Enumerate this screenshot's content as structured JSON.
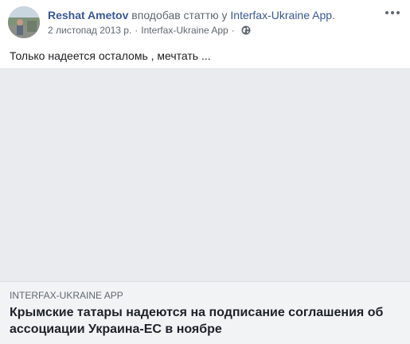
{
  "post": {
    "author": "Reshat Ametov",
    "action": "вподобав статтю у",
    "app_name": "Interfax-Ukraine App",
    "app_suffix": ".",
    "date": "2 листопад 2013 р.",
    "separator": "·",
    "via_app": "Interfax-Ukraine App",
    "separator2": "·",
    "privacy_icon": "globe-icon",
    "more_icon": "more-options-icon",
    "text": "Только надеется осталомь , мечтать ..."
  },
  "attachment": {
    "source": "INTERFAX-UKRAINE APP",
    "headline": "Крымские татары надеются на подписание соглашения об ассоциации Украина-ЕС в ноябре"
  },
  "colors": {
    "link": "#385898",
    "secondary_text": "#606770",
    "media_placeholder": "#e9ebee",
    "caption_background": "#f2f3f5"
  }
}
